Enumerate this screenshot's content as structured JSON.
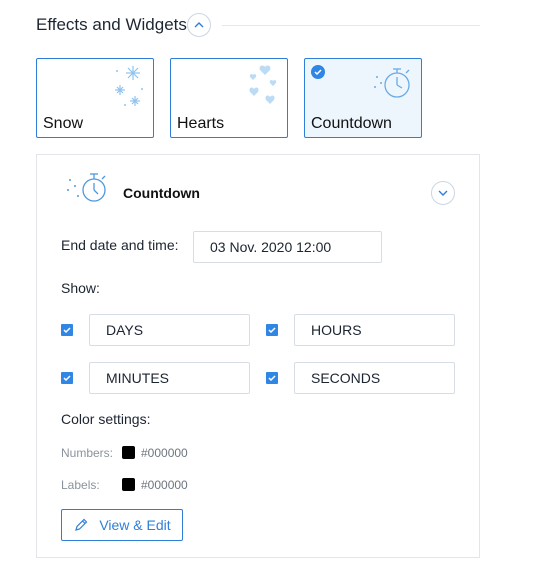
{
  "section": {
    "title": "Effects and Widgets"
  },
  "effects": [
    {
      "label": "Snow",
      "selected": false,
      "icon": "snowflakes"
    },
    {
      "label": "Hearts",
      "selected": false,
      "icon": "hearts"
    },
    {
      "label": "Countdown",
      "selected": true,
      "icon": "stopwatch"
    }
  ],
  "countdown": {
    "title": "Countdown",
    "icon": "stopwatch",
    "end_label": "End date and time:",
    "end_value": "03 Nov. 2020 12:00",
    "show_label": "Show:",
    "units": [
      {
        "label": "DAYS",
        "checked": true
      },
      {
        "label": "HOURS",
        "checked": true
      },
      {
        "label": "MINUTES",
        "checked": true
      },
      {
        "label": "SECONDS",
        "checked": true
      }
    ],
    "color_settings_label": "Color settings:",
    "numbers_label": "Numbers:",
    "numbers_color": "#000000",
    "labels_label": "Labels:",
    "labels_color": "#000000",
    "view_edit_label": "View & Edit"
  },
  "colors": {
    "accent": "#2f7fd8",
    "check": "#2f86e4",
    "selected_bg": "#eef6fd"
  }
}
